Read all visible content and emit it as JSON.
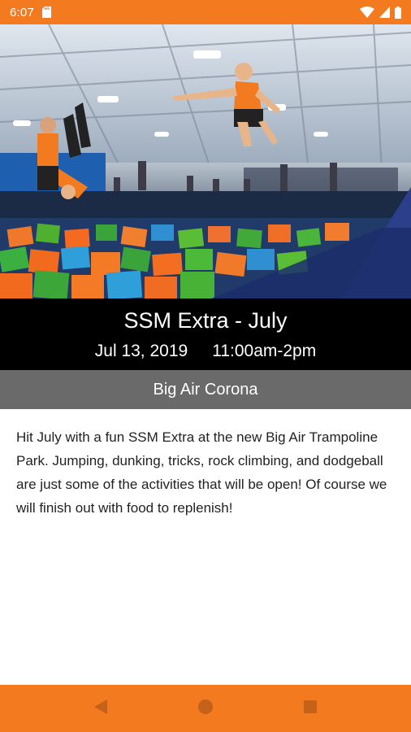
{
  "status_bar": {
    "time": "6:07",
    "icons": [
      "sd-card-icon",
      "wifi-icon",
      "cell-signal-icon",
      "battery-icon"
    ]
  },
  "hero": {
    "image": "trampoline-park-photo"
  },
  "event": {
    "title": "SSM Extra - July",
    "date": "Jul 13, 2019",
    "time": "11:00am-2pm",
    "location": "Big Air Corona",
    "description": "Hit July with a fun SSM Extra at the new Big Air Trampoline Park. Jumping, dunking, tricks, rock climbing, and dodgeball are just some of the activities that will be open! Of course we will finish out with food to replenish!"
  },
  "nav_bar": {
    "buttons": [
      "back-icon",
      "home-icon",
      "recents-icon"
    ]
  },
  "colors": {
    "accent": "#f47a20",
    "title_band": "#000000",
    "location_band": "#6a6a6a",
    "text": "#222222"
  }
}
